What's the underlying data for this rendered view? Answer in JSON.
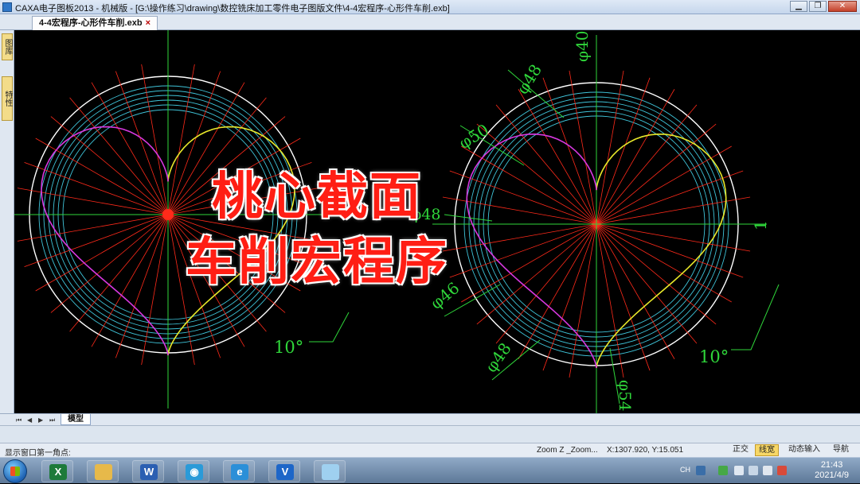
{
  "window": {
    "title": "CAXA电子图板2013 - 机械版 - [G:\\操作练习\\drawing\\数控铣床加工零件电子图版文件\\4-4宏程序-心形件车削.exb]",
    "min_symbol": "▁",
    "max_symbol": "❐",
    "close_symbol": "✕"
  },
  "document_tab": {
    "label": "4-4宏程序-心形件车削.exb",
    "close_symbol": "×"
  },
  "side_panel": {
    "tabs": [
      "图库",
      "特性"
    ]
  },
  "overlay": {
    "line1": "桃心截面",
    "line2": "车削宏程序"
  },
  "chart_data": {
    "type": "cad-drawing",
    "dimensions": [
      {
        "text": "φ40",
        "color": "#2fd63a"
      },
      {
        "text": "φ48",
        "color": "#2fd63a"
      },
      {
        "text": "φ50",
        "color": "#2fd63a"
      },
      {
        "text": "φ48",
        "color": "#2fd63a"
      },
      {
        "text": "1",
        "color": "#2fd63a"
      },
      {
        "text": "φ46",
        "color": "#2fd63a"
      },
      {
        "text": "φ48",
        "color": "#2fd63a"
      },
      {
        "text": "φ54",
        "color": "#2fd63a"
      },
      {
        "text": "10°",
        "color": "#2fd63a"
      },
      {
        "text": "10°",
        "color": "#2fd63a"
      }
    ],
    "colors": {
      "circle": "#ffffff",
      "rings": "#3fc4d9",
      "radial": "#ff2a1a",
      "center_lines": "#2fd63a",
      "heart_yellow": "#e8e82a",
      "heart_magenta": "#d838e0",
      "centre_mark": "#ff2a1a"
    },
    "radial_step_deg": 10
  },
  "sheet_tabs": {
    "nav": [
      "⏮",
      "◀",
      "▶",
      "⏭"
    ],
    "active": "模型"
  },
  "status": {
    "prompt": "显示窗口第一角点:",
    "zoom": "Zoom Z _Zoom...",
    "coords": "X:1307.920, Y:15.051",
    "buttons": [
      {
        "label": "正交",
        "active": false
      },
      {
        "label": "线宽",
        "active": true
      },
      {
        "label": "动态输入",
        "active": false
      },
      {
        "label": "导航",
        "active": false
      }
    ]
  },
  "taskbar": {
    "apps": [
      {
        "name": "excel-app-icon",
        "glyph": "X",
        "color": "#1e7a3a"
      },
      {
        "name": "explorer-app-icon",
        "glyph": "",
        "color": "#e7b94a"
      },
      {
        "name": "word-app-icon",
        "glyph": "W",
        "color": "#2b5fb2"
      },
      {
        "name": "media-app-icon",
        "glyph": "◉",
        "color": "#2a9ad8"
      },
      {
        "name": "ie-app-icon",
        "glyph": "e",
        "color": "#2b8fd8"
      },
      {
        "name": "caxa-app-icon",
        "glyph": "V",
        "color": "#1d66c8"
      },
      {
        "name": "notes-app-icon",
        "glyph": "",
        "color": "#9fd0f0"
      }
    ],
    "ime": "CH",
    "time": "21:43",
    "date": "2021/4/9"
  }
}
